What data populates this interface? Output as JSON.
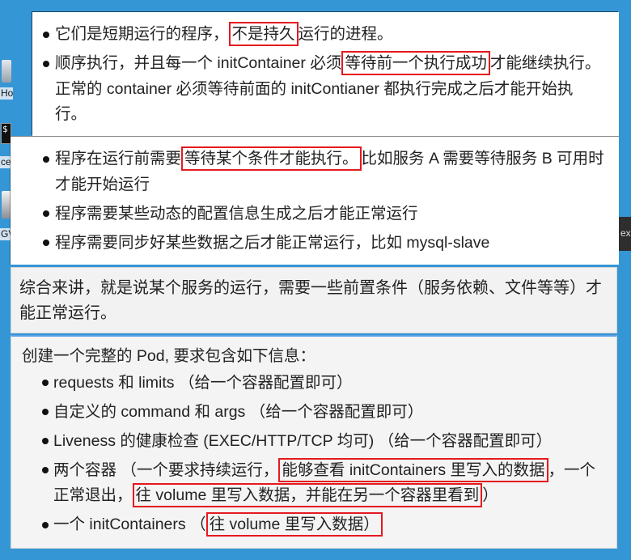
{
  "colors": {
    "desktop_background": "#3596d6",
    "highlight_border": "#e5191e",
    "text": "#222222"
  },
  "desktop": {
    "icons": [
      {
        "icon": "home-folder-icon",
        "label": "Ho"
      },
      {
        "icon": "terminal-icon",
        "glyph": "$",
        "label": "ce"
      },
      {
        "icon": "application-icon",
        "label": "GV"
      }
    ],
    "edge_window": {
      "label": "ex"
    }
  },
  "panel1": {
    "items": [
      {
        "lines": [
          {
            "before": "它们是短期运行的程序，",
            "highlight": "不是持久",
            "after": "运行的进程。"
          }
        ]
      },
      {
        "lines": [
          {
            "before": "顺序执行，并且每一个 initContainer 必须",
            "highlight": "等待前一个执行成功",
            "after": "才能继续执行。"
          },
          {
            "text": "正常的 container 必须等待前面的 initContianer 都执行完成之后才能开始执"
          },
          {
            "text": "行。"
          }
        ]
      }
    ]
  },
  "panel2": {
    "items": [
      {
        "lines": [
          {
            "before": "程序在运行前需要",
            "highlight": "等待某个条件才能执行。",
            "after": "比如服务 A 需要等待服务 B 可用时"
          },
          {
            "text": "才能开始运行"
          }
        ]
      },
      {
        "lines": [
          {
            "text": "程序需要某些动态的配置信息生成之后才能正常运行"
          }
        ]
      },
      {
        "lines": [
          {
            "text": "程序需要同步好某些数据之后才能正常运行，比如 mysql-slave"
          }
        ]
      }
    ]
  },
  "summary": {
    "lines": [
      "综合来讲，就是说某个服务的运行，需要一些前置条件（服务依赖、文件等等）才",
      "能正常运行。"
    ]
  },
  "task": {
    "title": "创建一个完整的 Pod, 要求包含如下信息：",
    "items": [
      {
        "lines": [
          {
            "text": "requests 和 limits （给一个容器配置即可）"
          }
        ]
      },
      {
        "lines": [
          {
            "text": "自定义的 command 和 args （给一个容器配置即可）"
          }
        ]
      },
      {
        "lines": [
          {
            "text": "Liveness 的健康检查 (EXEC/HTTP/TCP 均可) （给一个容器配置即可）"
          }
        ]
      },
      {
        "lines": [
          {
            "before": "两个容器 （一个要求持续运行，",
            "highlight": "能够查看 initContainers 里写入的数据",
            "after": "，一个"
          },
          {
            "before": "正常退出，",
            "highlight": "往 volume 里写入数据，并能在另一个容器里看到",
            "after": "）"
          }
        ]
      },
      {
        "lines": [
          {
            "before": "一个 initContainers （",
            "highlight": "往 volume 里写入数据）"
          }
        ]
      }
    ]
  }
}
